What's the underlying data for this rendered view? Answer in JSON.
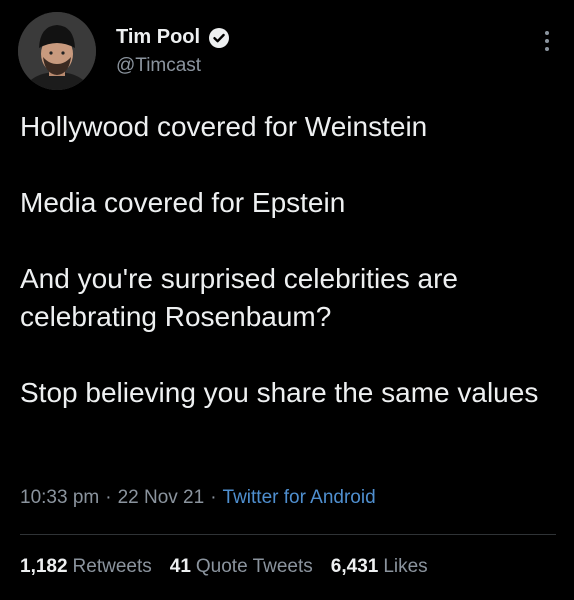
{
  "author": {
    "display_name": "Tim Pool",
    "handle": "@Timcast",
    "verified": true
  },
  "tweet": {
    "paragraphs": [
      "Hollywood covered for Weinstein",
      "Media covered for Epstein",
      "And you're surprised celebrities are celebrating Rosenbaum?",
      "Stop believing you share the same values"
    ],
    "time": "10:33 pm",
    "date": "22 Nov 21",
    "source": "Twitter for Android",
    "separator": "·"
  },
  "stats": {
    "retweets_count": "1,182",
    "retweets_label": "Retweets",
    "quote_count": "41",
    "quote_label": "Quote Tweets",
    "likes_count": "6,431",
    "likes_label": "Likes"
  },
  "colors": {
    "background": "#000000",
    "text_primary": "#eef0f1",
    "text_secondary": "#8b949e",
    "link": "#4f8fcf"
  },
  "icons": {
    "verified": "verified-badge-icon",
    "more": "more-vertical-icon"
  }
}
